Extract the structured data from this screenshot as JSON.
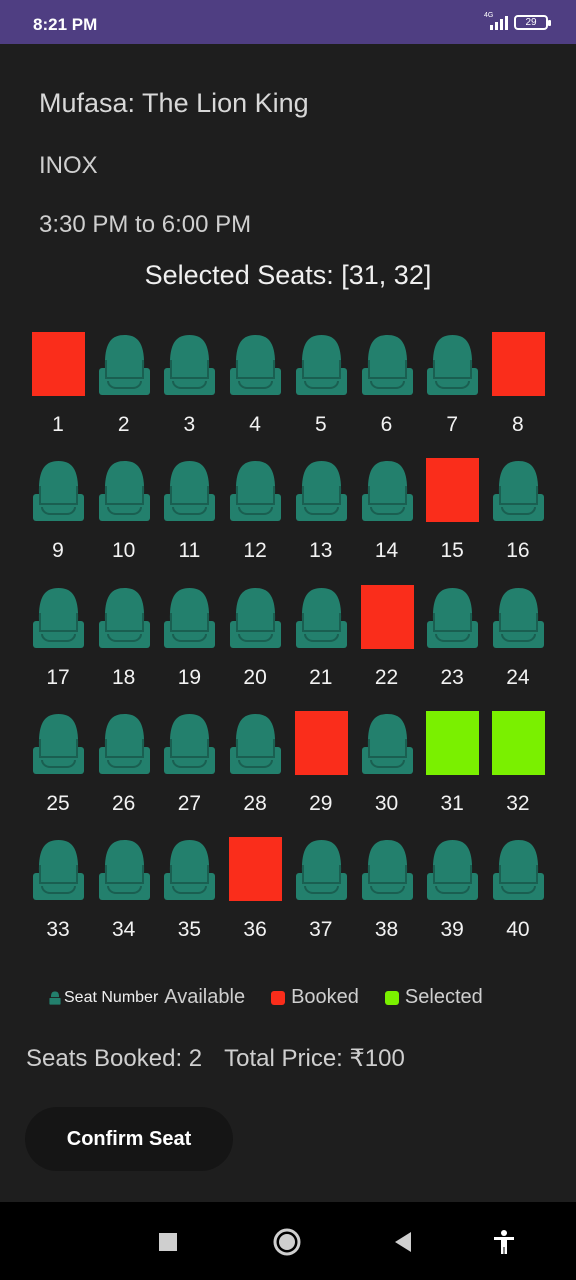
{
  "status_bar": {
    "time": "8:21 PM",
    "network_label": "4G",
    "battery": "29"
  },
  "movie": {
    "title": "Mufasa: The Lion King",
    "theatre": "INOX",
    "showtime": "3:30 PM to 6:00 PM"
  },
  "selected_seats_text": "Selected Seats: [31, 32]",
  "seats": [
    {
      "number": "1",
      "status": "booked"
    },
    {
      "number": "2",
      "status": "available"
    },
    {
      "number": "3",
      "status": "available"
    },
    {
      "number": "4",
      "status": "available"
    },
    {
      "number": "5",
      "status": "available"
    },
    {
      "number": "6",
      "status": "available"
    },
    {
      "number": "7",
      "status": "available"
    },
    {
      "number": "8",
      "status": "booked"
    },
    {
      "number": "9",
      "status": "available"
    },
    {
      "number": "10",
      "status": "available"
    },
    {
      "number": "11",
      "status": "available"
    },
    {
      "number": "12",
      "status": "available"
    },
    {
      "number": "13",
      "status": "available"
    },
    {
      "number": "14",
      "status": "available"
    },
    {
      "number": "15",
      "status": "booked"
    },
    {
      "number": "16",
      "status": "available"
    },
    {
      "number": "17",
      "status": "available"
    },
    {
      "number": "18",
      "status": "available"
    },
    {
      "number": "19",
      "status": "available"
    },
    {
      "number": "20",
      "status": "available"
    },
    {
      "number": "21",
      "status": "available"
    },
    {
      "number": "22",
      "status": "booked"
    },
    {
      "number": "23",
      "status": "available"
    },
    {
      "number": "24",
      "status": "available"
    },
    {
      "number": "25",
      "status": "available"
    },
    {
      "number": "26",
      "status": "available"
    },
    {
      "number": "27",
      "status": "available"
    },
    {
      "number": "28",
      "status": "available"
    },
    {
      "number": "29",
      "status": "booked"
    },
    {
      "number": "30",
      "status": "available"
    },
    {
      "number": "31",
      "status": "selected"
    },
    {
      "number": "32",
      "status": "selected"
    },
    {
      "number": "33",
      "status": "available"
    },
    {
      "number": "34",
      "status": "available"
    },
    {
      "number": "35",
      "status": "available"
    },
    {
      "number": "36",
      "status": "booked"
    },
    {
      "number": "37",
      "status": "available"
    },
    {
      "number": "38",
      "status": "available"
    },
    {
      "number": "39",
      "status": "available"
    },
    {
      "number": "40",
      "status": "available"
    }
  ],
  "legend": {
    "seat_number_label": "Seat Number",
    "available_label": "Available",
    "booked_label": "Booked",
    "selected_label": "Selected"
  },
  "summary": {
    "seats_booked": "Seats Booked: 2",
    "total_price": "Total Price: ₹100"
  },
  "confirm_button_label": "Confirm Seat",
  "nav": {
    "icons": [
      "recents-square-icon",
      "home-circle-icon",
      "back-triangle-icon",
      "accessibility-icon"
    ]
  },
  "colors": {
    "status_bar": "#4f3e82",
    "background": "#1e1e1e",
    "seat_available": "#23806d",
    "seat_booked": "#fa2d1b",
    "seat_selected": "#7af000"
  }
}
